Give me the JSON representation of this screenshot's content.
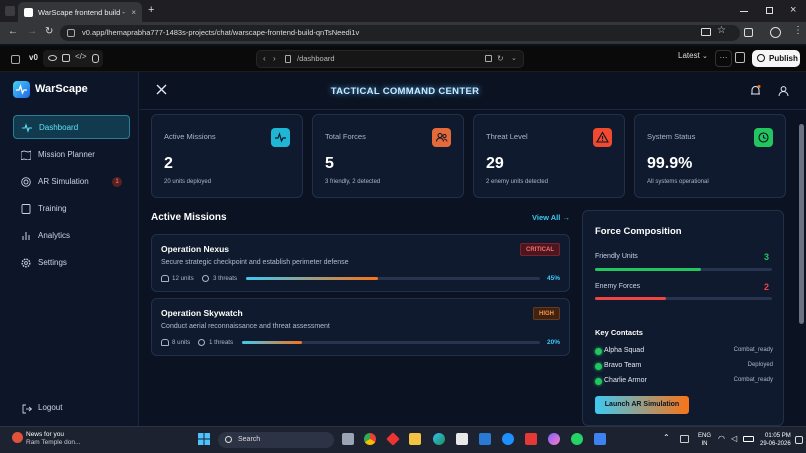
{
  "browser": {
    "tab_title": "WarScape frontend build - v0 b",
    "url": "v0.app/lhemaprabha777-1483s-projects/chat/warscape-frontend-build-qnTsNeedi1v"
  },
  "v0": {
    "route": "/dashboard",
    "version_label": "Latest",
    "publish_label": "Publish"
  },
  "brand": {
    "name": "WarScape"
  },
  "sidebar": {
    "items": [
      {
        "label": "Dashboard"
      },
      {
        "label": "Mission Planner"
      },
      {
        "label": "AR Simulation",
        "badge": "1"
      },
      {
        "label": "Training"
      },
      {
        "label": "Analytics"
      },
      {
        "label": "Settings"
      }
    ],
    "logout_label": "Logout"
  },
  "header": {
    "title": "TACTICAL COMMAND CENTER"
  },
  "stats": [
    {
      "label": "Active Missions",
      "value": "2",
      "sub": "20 units deployed",
      "color": "#1fb6d6"
    },
    {
      "label": "Total Forces",
      "value": "5",
      "sub": "3 friendly, 2 detected",
      "color": "#e4693b"
    },
    {
      "label": "Threat Level",
      "value": "29",
      "sub": "2 enemy units detected",
      "color": "#ef4a2f"
    },
    {
      "label": "System Status",
      "value": "99.9%",
      "sub": "All systems operational",
      "color": "#22c55e"
    }
  ],
  "missions": {
    "title": "Active Missions",
    "view_all": "View All",
    "items": [
      {
        "name": "Operation Nexus",
        "desc": "Secure strategic checkpoint and establish perimeter defense",
        "tag": "CRITICAL",
        "units": "12 units",
        "threats": "3 threats",
        "progress": 0.45,
        "progress_label": "45%"
      },
      {
        "name": "Operation Skywatch",
        "desc": "Conduct aerial reconnaissance and threat assessment",
        "tag": "HIGH",
        "units": "8 units",
        "threats": "1 threats",
        "progress": 0.2,
        "progress_label": "20%"
      }
    ]
  },
  "force": {
    "title": "Force Composition",
    "friendly_label": "Friendly Units",
    "friendly_value": "3",
    "friendly_ratio": 0.6,
    "enemy_label": "Enemy Forces",
    "enemy_value": "2",
    "enemy_ratio": 0.4,
    "contacts_title": "Key Contacts",
    "contacts": [
      {
        "name": "Alpha Squad",
        "status": "Combat_ready"
      },
      {
        "name": "Bravo Team",
        "status": "Deployed"
      },
      {
        "name": "Charlie Armor",
        "status": "Combat_ready"
      }
    ],
    "ar_button": "Launch AR Simulation"
  },
  "taskbar": {
    "news_title": "News for you",
    "news_sub": "Ram Temple don...",
    "search": "Search",
    "lang_1": "ENG",
    "lang_2": "IN",
    "time": "01:05 PM",
    "date": "29-06-2026"
  }
}
